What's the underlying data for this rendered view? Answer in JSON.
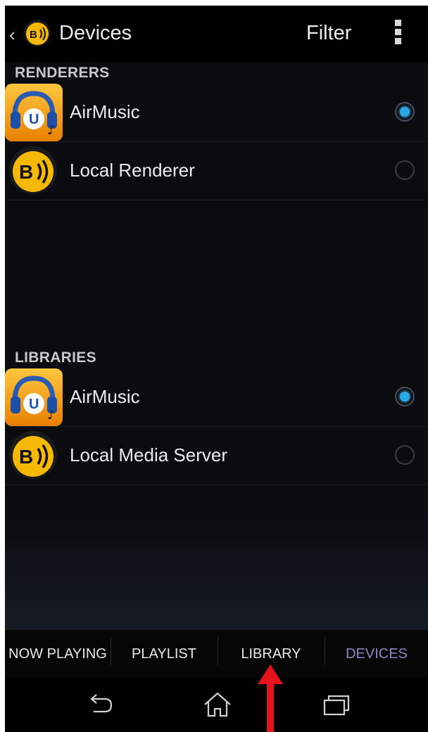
{
  "action_bar": {
    "back_glyph": "‹",
    "title": "Devices",
    "filter_label": "Filter",
    "overflow_icon": "overflow-menu-icon"
  },
  "renderers": {
    "header": "RENDERERS",
    "items": [
      {
        "name": "AirMusic",
        "icon": "airmusic-headphones-icon",
        "selected": true
      },
      {
        "name": "Local Renderer",
        "icon": "bubbleupnp-logo-icon",
        "selected": false
      }
    ]
  },
  "libraries": {
    "header": "LIBRARIES",
    "items": [
      {
        "name": "AirMusic",
        "icon": "airmusic-headphones-icon",
        "selected": true
      },
      {
        "name": "Local Media Server",
        "icon": "bubbleupnp-logo-icon",
        "selected": false
      }
    ]
  },
  "tabs": [
    {
      "label": "NOW PLAYING",
      "active": false
    },
    {
      "label": "PLAYLIST",
      "active": false
    },
    {
      "label": "LIBRARY",
      "active": false
    },
    {
      "label": "DEVICES",
      "active": true
    }
  ],
  "nav": {
    "back": "back-icon",
    "home": "home-icon",
    "recents": "recent-apps-icon"
  },
  "colors": {
    "background": "#0b0c10",
    "accent_radio": "#2aa8e6",
    "active_tab": "#8c87c4",
    "logo_yellow": "#f6b800",
    "annotation_arrow": "#e3121b"
  }
}
